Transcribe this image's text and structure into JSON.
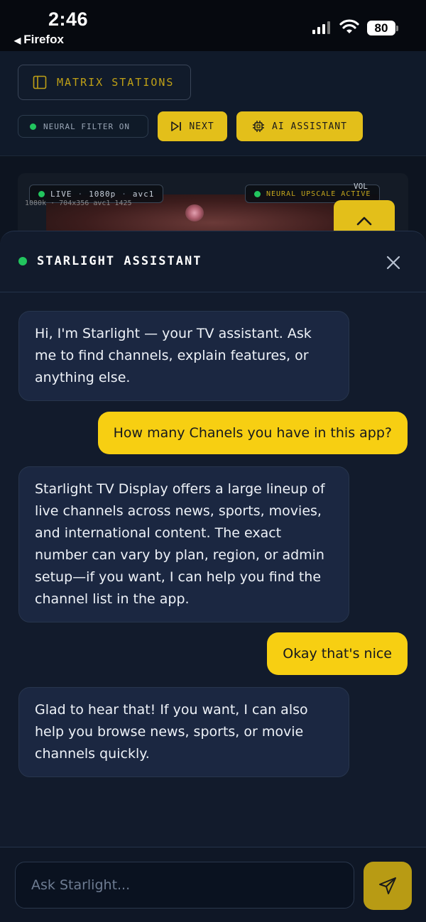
{
  "status_bar": {
    "time": "2:46",
    "back_app": "Firefox",
    "battery": "80"
  },
  "app": {
    "matrix_button": "MATRIX STATIONS",
    "filter_status": "NEURAL FILTER ON",
    "next_button": "NEXT",
    "ai_button": "AI ASSISTANT",
    "player": {
      "live": "LIVE",
      "resolution": "1080p",
      "codec": "avc1",
      "codec_detail": "1080k · 704x356 avc1 1425",
      "upscale": "NEURAL UPSCALE ACTIVE",
      "vol": "VOL"
    }
  },
  "assistant": {
    "title": "STARLIGHT ASSISTANT",
    "messages": [
      {
        "role": "bot",
        "text": "Hi, I'm Starlight — your TV assistant. Ask me to find channels, explain features, or anything else."
      },
      {
        "role": "user",
        "text": "How many Chanels you have in this app?"
      },
      {
        "role": "bot",
        "text": "Starlight TV Display offers a large lineup of live channels across news, sports, movies, and international content. The exact number can vary by plan, region, or admin setup—if you want, I can help you find the channel list in the app."
      },
      {
        "role": "user",
        "text": "Okay that's nice"
      },
      {
        "role": "bot",
        "text": "Glad to hear that! If you want, I can also help you browse news, sports, or movie channels quickly."
      }
    ],
    "input_placeholder": "Ask Starlight..."
  },
  "colors": {
    "accent": "#f7cf12",
    "status_live": "#22c55e",
    "panel_bg": "#121b2c",
    "bot_bubble": "#1b2741"
  }
}
